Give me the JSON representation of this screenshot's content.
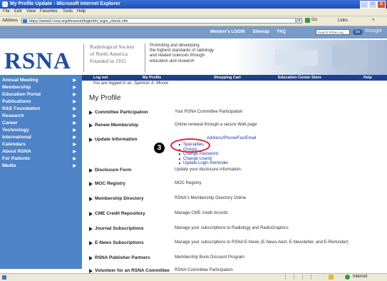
{
  "window": {
    "title": "My Profile Update - Microsoft Internet Explorer",
    "minimize": "_",
    "maximize": "□",
    "close": "X"
  },
  "menu": [
    "File",
    "Edit",
    "View",
    "Favorites",
    "Tools",
    "Help"
  ],
  "address": {
    "label": "Address",
    "url": "https://www2.rsna.org/timssnet/login/tnt_login_check.cfm",
    "go_label": "Go",
    "links_label": "Links"
  },
  "site_nav": {
    "members_login": "Member's LOGIN",
    "sitemap": "Sitemap",
    "faq": "FAQ",
    "search_placeholder": "Search RSNA.org",
    "go": "Go",
    "google": "Google"
  },
  "header": {
    "logo": "RSNA",
    "society_lines": [
      "Radiological Society",
      "of North America",
      "Founded in 1915"
    ],
    "tagline_lines": [
      "Promoting and developing",
      "the highest standards of radiology",
      "and related sciences through",
      "education and research"
    ]
  },
  "subnav": {
    "logout": "Log out",
    "my_profile": "My Profile",
    "shopping_cart": "Shopping Cart",
    "education_center": "Education Center Store",
    "help": "Help"
  },
  "sidebar": [
    "Annual Meeting",
    "Membership",
    "Education Portal",
    "Publications",
    "R&E Foundation",
    "Research",
    "Career",
    "Technology",
    "International",
    "Calendars",
    "About RSNA",
    "For Patients",
    "Media"
  ],
  "content": {
    "logged_in_text": "You are logged in as: Spencer A. Moore",
    "page_title": "My Profile",
    "rows": [
      {
        "name": "Committee Participation",
        "desc": "Your RSNA Committee Participation"
      },
      {
        "name": "Renew Membership",
        "desc": "Online renewal through a secure Web page"
      },
      {
        "name": "Update Information",
        "desc": ""
      },
      {
        "name": "Disclosure Form",
        "desc": "Update your disclosure information."
      },
      {
        "name": "MOC Registry",
        "desc": "MOC Registry"
      },
      {
        "name": "Membership Directory",
        "desc": "RSNA's Membership Directory Online"
      },
      {
        "name": "CME Credit Repository",
        "desc": "Manage CME credit records"
      },
      {
        "name": "Journal Subscriptions",
        "desc": "Manage your subscriptions to Radiology and RadioGraphics"
      },
      {
        "name": "E-News Subscriptions",
        "desc": "Manage your subscriptions to RSNA E-News (E-News Alert, E-Newsletter, and E-Reminder)"
      },
      {
        "name": "RSNA Publisher Partners",
        "desc": "Membership Book Discount Program"
      },
      {
        "name": "Volunteer for an RSNA Committee",
        "desc": "RSNA Committee Participation"
      }
    ],
    "update_info_links": {
      "obscured": "Address/Phone/Fax/Email",
      "items": [
        "Specialties",
        "Groups",
        "Change Password",
        "Change Userid",
        "Update Login Reminder"
      ]
    },
    "marker_number": "3"
  },
  "statusbar": {
    "zone": "Internet"
  }
}
